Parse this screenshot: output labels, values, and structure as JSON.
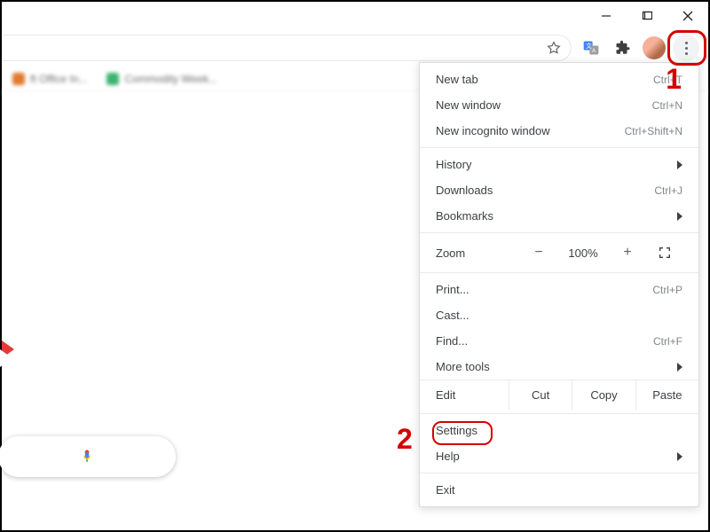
{
  "bookmarks": [
    {
      "label": "ft Office In..."
    },
    {
      "label": "Commodity Week..."
    }
  ],
  "menu": {
    "new_tab": {
      "label": "New tab",
      "shortcut": "Ctrl+T"
    },
    "new_window": {
      "label": "New window",
      "shortcut": "Ctrl+N"
    },
    "incognito": {
      "label": "New incognito window",
      "shortcut": "Ctrl+Shift+N"
    },
    "history": {
      "label": "History"
    },
    "downloads": {
      "label": "Downloads",
      "shortcut": "Ctrl+J"
    },
    "bookmarks": {
      "label": "Bookmarks"
    },
    "zoom": {
      "label": "Zoom",
      "minus": "−",
      "value": "100%",
      "plus": "+"
    },
    "print": {
      "label": "Print...",
      "shortcut": "Ctrl+P"
    },
    "cast": {
      "label": "Cast..."
    },
    "find": {
      "label": "Find...",
      "shortcut": "Ctrl+F"
    },
    "more_tools": {
      "label": "More tools"
    },
    "edit": {
      "label": "Edit",
      "cut": "Cut",
      "copy": "Copy",
      "paste": "Paste"
    },
    "settings": {
      "label": "Settings"
    },
    "help": {
      "label": "Help"
    },
    "exit": {
      "label": "Exit"
    }
  },
  "callouts": {
    "one": "1",
    "two": "2"
  }
}
